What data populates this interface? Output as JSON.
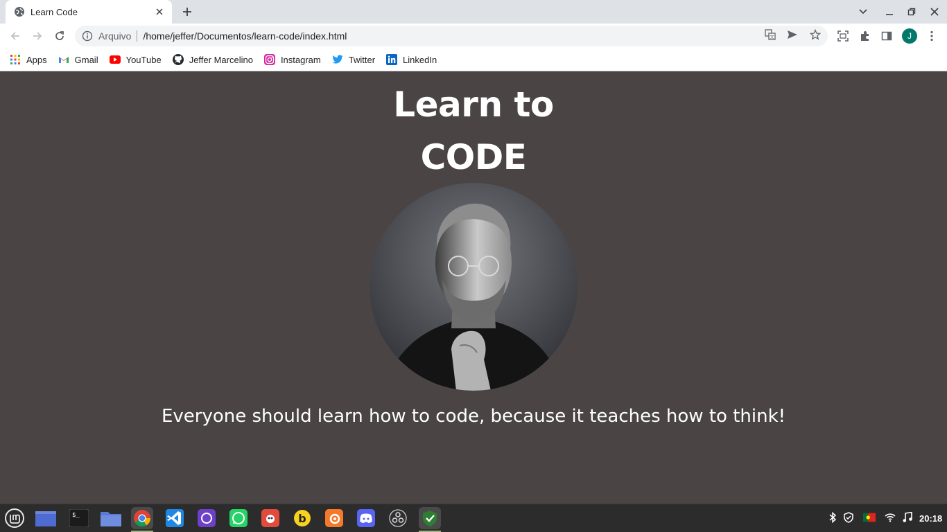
{
  "browser": {
    "tab_title": "Learn Code",
    "omnibox_scheme": "Arquivo",
    "omnibox_url": "/home/jeffer/Documentos/learn-code/index.html",
    "avatar_initial": "J"
  },
  "bookmarks": [
    {
      "label": "Apps",
      "icon": "apps-grid-icon"
    },
    {
      "label": "Gmail",
      "icon": "gmail-icon"
    },
    {
      "label": "YouTube",
      "icon": "youtube-icon"
    },
    {
      "label": "Jeffer Marcelino",
      "icon": "github-icon"
    },
    {
      "label": "Instagram",
      "icon": "instagram-icon"
    },
    {
      "label": "Twitter",
      "icon": "twitter-icon"
    },
    {
      "label": "LinkedIn",
      "icon": "linkedin-icon"
    }
  ],
  "page": {
    "heading_line1": "Learn to",
    "heading_line2": "CODE",
    "tagline": "Everyone should learn how to code, because it teaches how to think!",
    "background_color": "#4a4445"
  },
  "taskbar": {
    "apps": [
      "mint-menu-icon",
      "show-desktop-icon",
      "terminal-icon",
      "files-icon",
      "chrome-icon",
      "vscode-icon",
      "github-desktop-icon",
      "whatsapp-icon",
      "gimp-icon",
      "bitwarden-icon",
      "blender-icon",
      "discord-icon",
      "obs-icon",
      "shield-app-icon"
    ],
    "clock": "20:18"
  }
}
